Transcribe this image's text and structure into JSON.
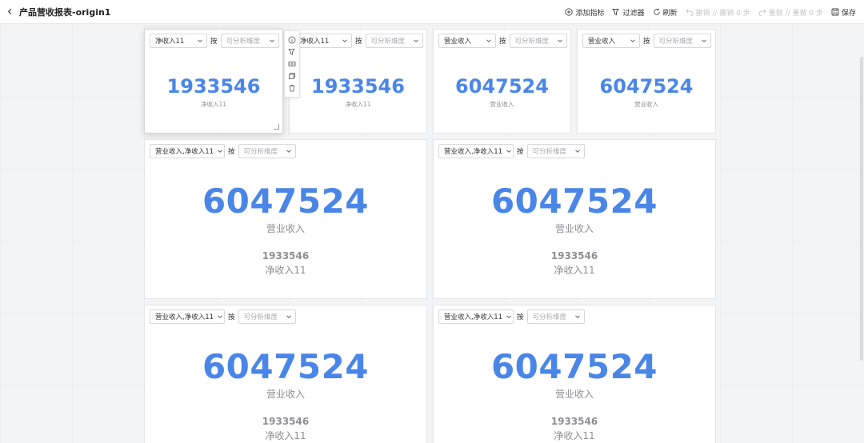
{
  "header": {
    "title": "产品营收报表-origin1",
    "add_metric": "添加指标",
    "filter": "过滤器",
    "refresh": "刷新",
    "undo": "撤销 // 撤销 0 步",
    "redo": "重做 // 重做 0 步",
    "save": "保存"
  },
  "common": {
    "by": "按",
    "dimension_placeholder": "可分析维度"
  },
  "cards": [
    {
      "metric_select": "净收入11",
      "value": "1933546",
      "label": "净收入11"
    },
    {
      "metric_select": "净收入11",
      "value": "1933546",
      "label": "净收入11"
    },
    {
      "metric_select": "营业收入",
      "value": "6047524",
      "label": "营业收入"
    },
    {
      "metric_select": "营业收入",
      "value": "6047524",
      "label": "营业收入"
    },
    {
      "metric_select": "营业收入,净收入11",
      "value": "6047524",
      "label": "营业收入",
      "secondary_value": "1933546",
      "secondary_label": "净收入11"
    },
    {
      "metric_select": "营业收入,净收入11",
      "value": "6047524",
      "label": "营业收入",
      "secondary_value": "1933546",
      "secondary_label": "净收入11"
    },
    {
      "metric_select": "营业收入,净收入11",
      "value": "6047524",
      "label": "营业收入",
      "secondary_value": "1933546",
      "secondary_label": "净收入11"
    },
    {
      "metric_select": "营业收入,净收入11",
      "value": "6047524",
      "label": "营业收入",
      "secondary_value": "1933546",
      "secondary_label": "净收入11"
    }
  ]
}
